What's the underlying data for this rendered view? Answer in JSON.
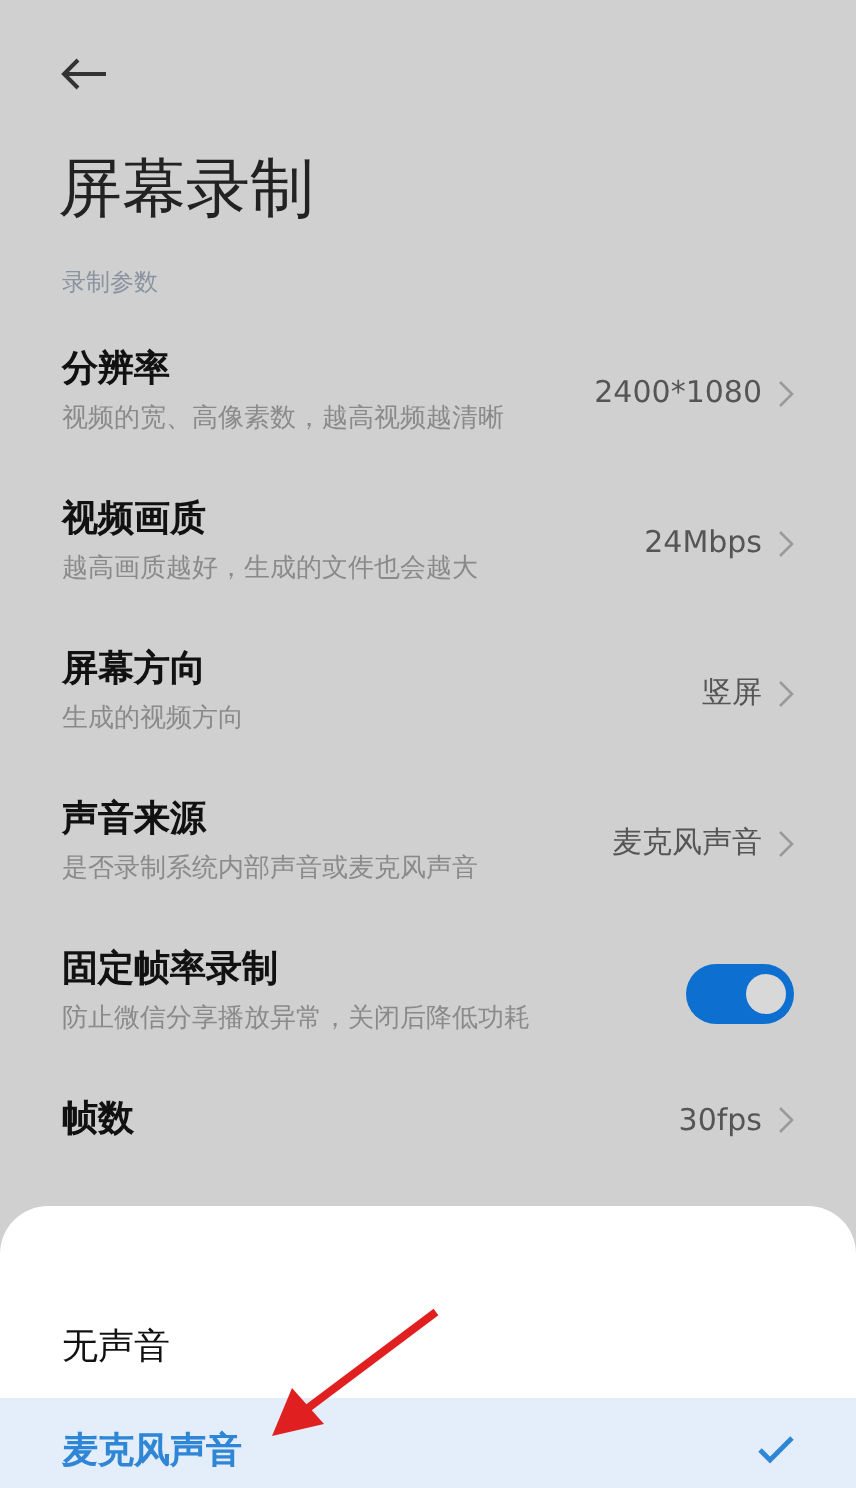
{
  "header": {
    "title": "屏幕录制"
  },
  "section": {
    "label": "录制参数"
  },
  "settings": [
    {
      "kind": "link",
      "title": "分辨率",
      "subtitle": "视频的宽、高像素数，越高视频越清晰",
      "value": "2400*1080"
    },
    {
      "kind": "link",
      "title": "视频画质",
      "subtitle": "越高画质越好，生成的文件也会越大",
      "value": "24Mbps"
    },
    {
      "kind": "link",
      "title": "屏幕方向",
      "subtitle": "生成的视频方向",
      "value": "竖屏"
    },
    {
      "kind": "link",
      "title": "声音来源",
      "subtitle": "是否录制系统内部声音或麦克风声音",
      "value": "麦克风声音"
    },
    {
      "kind": "switch",
      "title": "固定帧率录制",
      "subtitle": "防止微信分享播放异常，关闭后降低功耗",
      "on": true
    },
    {
      "kind": "link",
      "title": "帧数",
      "value": "30fps"
    }
  ],
  "sheet": {
    "options": [
      {
        "label": "无声音",
        "selected": false
      },
      {
        "label": "麦克风声音",
        "selected": true
      }
    ]
  }
}
